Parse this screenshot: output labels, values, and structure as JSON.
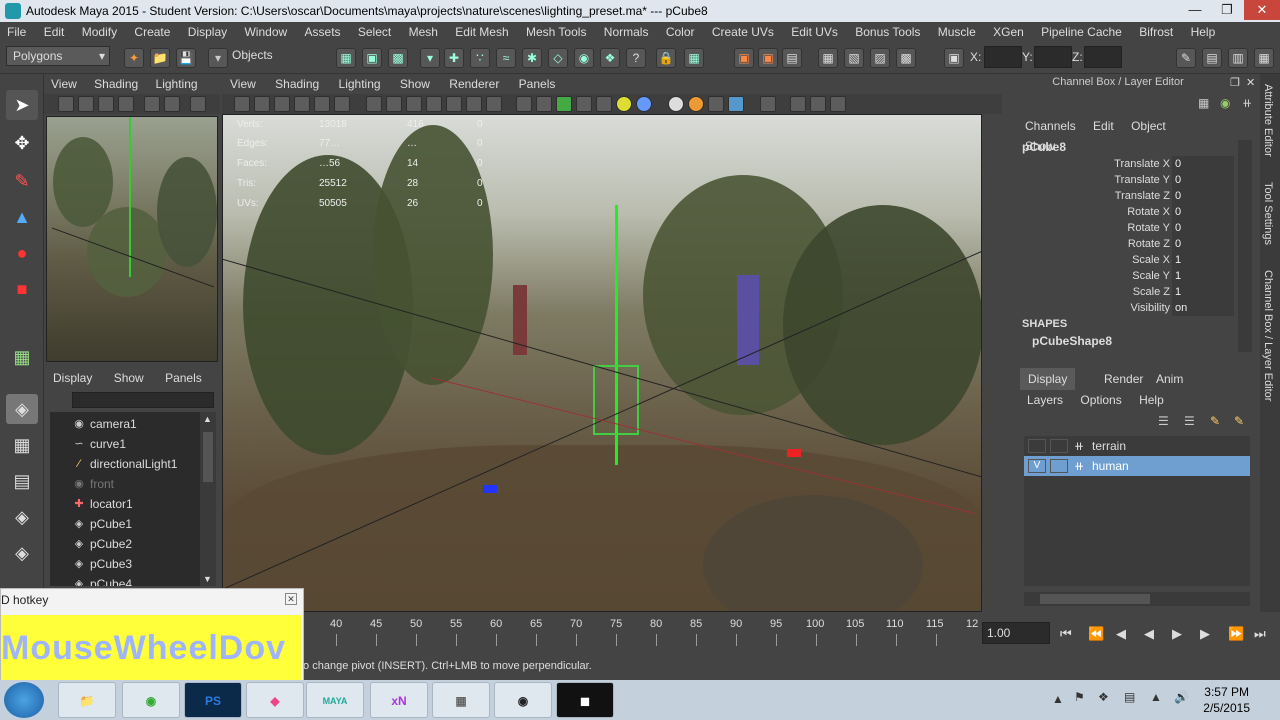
{
  "window": {
    "title": "Autodesk Maya 2015 - Student Version: C:\\Users\\oscar\\Documents\\maya\\projects\\nature\\scenes\\lighting_preset.ma*   ---   pCube8"
  },
  "menu": [
    "File",
    "Edit",
    "Modify",
    "Create",
    "Display",
    "Window",
    "Assets",
    "Select",
    "Mesh",
    "Edit Mesh",
    "Mesh Tools",
    "Normals",
    "Color",
    "Create UVs",
    "Edit UVs",
    "Bonus Tools",
    "Muscle",
    "XGen",
    "Pipeline Cache",
    "Bifrost",
    "Help"
  ],
  "shelf": {
    "mode_value": "Polygons",
    "objects_label": "Objects",
    "x_label": "X:",
    "y_label": "Y:",
    "z_label": "Z:"
  },
  "viewport_small": {
    "menu": [
      "View",
      "Shading",
      "Lighting"
    ]
  },
  "outliner": {
    "menu": [
      "Display",
      "Show",
      "Panels"
    ],
    "items": [
      "camera1",
      "curve1",
      "directionalLight1",
      "front",
      "locator1",
      "pCube1",
      "pCube2",
      "pCube3",
      "pCube4"
    ]
  },
  "viewport_main": {
    "menu": [
      "View",
      "Shading",
      "Lighting",
      "Show",
      "Renderer",
      "Panels"
    ],
    "hud": [
      {
        "label": "Verts:",
        "a": "13018",
        "b": "416",
        "c": "0"
      },
      {
        "label": "Edges:",
        "a": "77…",
        "b": "…",
        "c": "0"
      },
      {
        "label": "Faces:",
        "a": "…56",
        "b": "14",
        "c": "0"
      },
      {
        "label": "Tris:",
        "a": "25512",
        "b": "28",
        "c": "0"
      },
      {
        "label": "UVs:",
        "a": "50505",
        "b": "26",
        "c": "0"
      }
    ]
  },
  "channel_box": {
    "title": "Channel Box / Layer Editor",
    "menu": [
      "Channels",
      "Edit",
      "Object",
      "Show"
    ],
    "object": "pCube8",
    "attributes": [
      {
        "name": "Translate X",
        "value": "0"
      },
      {
        "name": "Translate Y",
        "value": "0"
      },
      {
        "name": "Translate Z",
        "value": "0"
      },
      {
        "name": "Rotate X",
        "value": "0"
      },
      {
        "name": "Rotate Y",
        "value": "0"
      },
      {
        "name": "Rotate Z",
        "value": "0"
      },
      {
        "name": "Scale X",
        "value": "1"
      },
      {
        "name": "Scale Y",
        "value": "1"
      },
      {
        "name": "Scale Z",
        "value": "1"
      },
      {
        "name": "Visibility",
        "value": "on"
      }
    ],
    "shapes_label": "SHAPES",
    "shape_name": "pCubeShape8"
  },
  "layer_editor": {
    "tabs": [
      "Display",
      "Render",
      "Anim"
    ],
    "menu": [
      "Layers",
      "Options",
      "Help"
    ],
    "layers": [
      {
        "name": "terrain",
        "visible": ""
      },
      {
        "name": "human",
        "visible": "V"
      }
    ]
  },
  "side_tabs": [
    "Attribute Editor",
    "Tool Settings",
    "Channel Box / Layer Editor"
  ],
  "timeline": {
    "ticks": [
      "40",
      "45",
      "50",
      "55",
      "60",
      "65",
      "70",
      "75",
      "80",
      "85",
      "90",
      "95",
      "100",
      "105",
      "110",
      "115",
      "12"
    ],
    "current": "1.00"
  },
  "help_line": "to change pivot (INSERT).  Ctrl+LMB to move perpendicular.",
  "hotkey_popup": {
    "title": "D hotkey",
    "text": "MouseWheelDov"
  },
  "taskbar": {
    "apps": [
      "PS",
      "MAYA",
      "xN",
      "",
      "",
      ""
    ],
    "time": "3:57 PM",
    "date": "2/5/2015"
  },
  "colors": {
    "accent": "#5285a6",
    "selected_layer": "#6e9fd0"
  }
}
